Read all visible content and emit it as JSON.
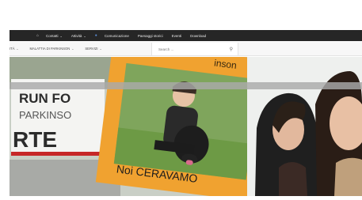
{
  "top_nav": {
    "items": [
      {
        "label": "Contatti",
        "has_dropdown": true
      },
      {
        "label": "Attività",
        "has_dropdown": true
      },
      {
        "label": "Comunicazione",
        "has_dropdown": false
      },
      {
        "label": "Paesaggi storici",
        "has_dropdown": false
      },
      {
        "label": "Eventi",
        "has_dropdown": false
      },
      {
        "label": "Download",
        "has_dropdown": false
      }
    ],
    "icons": [
      "home-icon",
      "person-icon"
    ]
  },
  "sub_nav": {
    "items": [
      {
        "label": "ITÀ",
        "has_dropdown": true
      },
      {
        "label": "MALATTIA DI PARKINSON",
        "has_dropdown": true
      },
      {
        "label": "SERVIZI",
        "has_dropdown": true
      }
    ]
  },
  "search": {
    "placeholder": "Search ...",
    "icon": "search-icon"
  },
  "hero": {
    "banner_lines": [
      "RUN FO",
      "PARKINSO",
      "RTE"
    ],
    "frame_top_text": "inson",
    "frame_bottom_text": "Noi CERAVAMO",
    "colors": {
      "frame": "#f0a230",
      "banner_red": "#c62828",
      "banner_dark": "#2b2b2b"
    }
  }
}
